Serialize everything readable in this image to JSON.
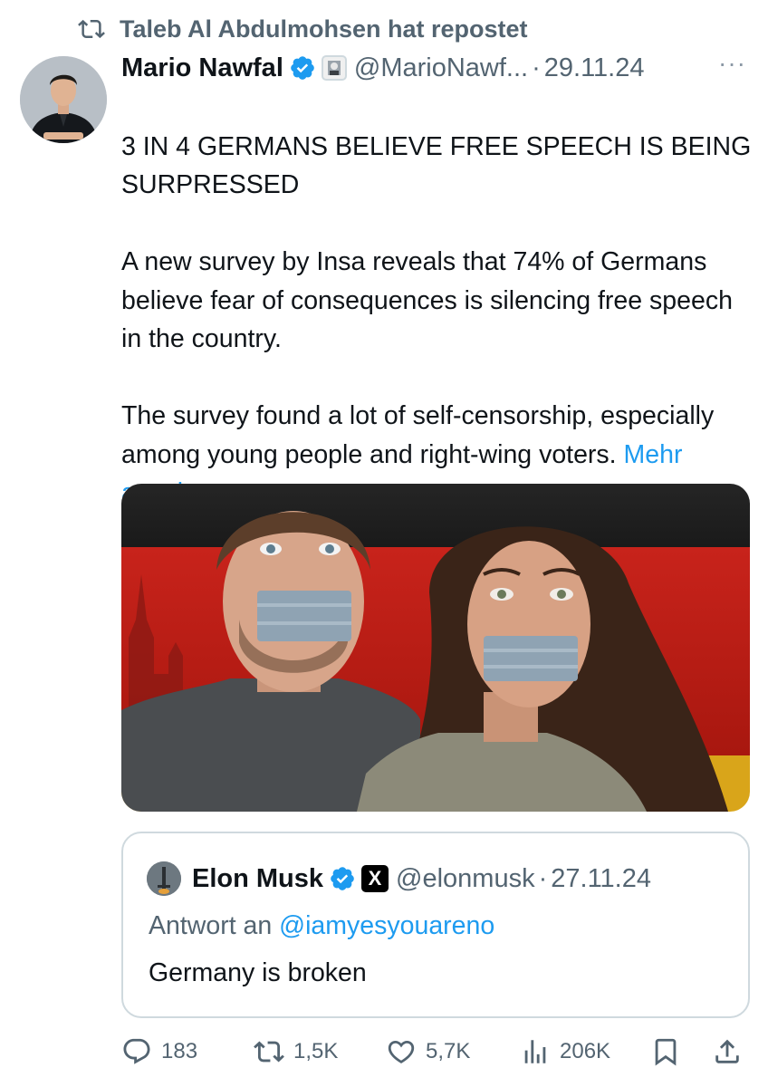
{
  "repost": {
    "text": "Taleb Al Abdulmohsen hat repostet"
  },
  "tweet": {
    "author_name": "Mario Nawfal",
    "handle": "@MarioNawf...",
    "separator": "·",
    "date": "29.11.24",
    "more": "···",
    "headline": "3 IN 4 GERMANS BELIEVE FREE SPEECH IS BEING SURPRESSED",
    "paragraph_1": "A new survey by Insa reveals that 74% of Germans believe fear of consequences is silencing free speech in the country.",
    "paragraph_2": "The survey found a lot of self-censorship, especially among young people and right-wing voters.",
    "show_more": "Mehr anzeigen"
  },
  "quote": {
    "author_name": "Elon Musk",
    "x_badge": "X",
    "handle": "@elonmusk",
    "separator": "·",
    "date": "27.11.24",
    "reply_prefix": "Antwort an",
    "reply_to": "@iamyesyouareno",
    "text": "Germany is broken"
  },
  "actions": {
    "replies": "183",
    "reposts": "1,5K",
    "likes": "5,7K",
    "views": "206K"
  },
  "icons": {
    "repost": "repost-icon",
    "verified": "verified-badge-icon",
    "reply": "reply-icon",
    "like": "heart-icon",
    "views": "views-icon",
    "bookmark": "bookmark-icon",
    "share": "share-icon"
  },
  "colors": {
    "text": "#0f1419",
    "secondary": "#536471",
    "link": "#1d9bf0",
    "border": "#cfd9de"
  }
}
